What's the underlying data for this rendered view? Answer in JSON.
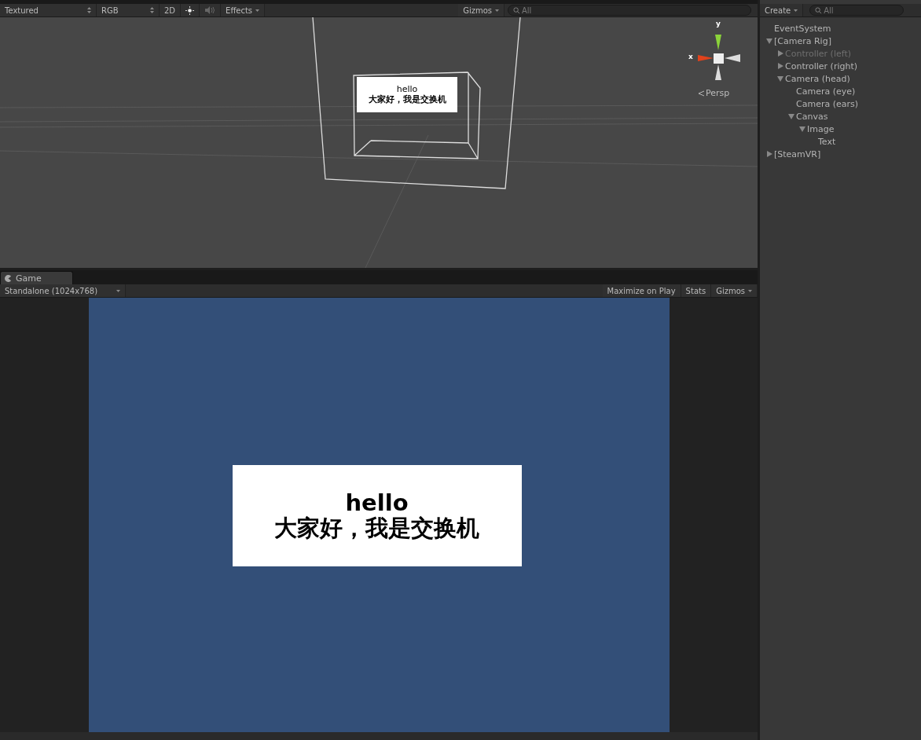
{
  "scene_toolbar": {
    "shading": "Textured",
    "channel": "RGB",
    "mode_2d": "2D",
    "lighting_on": true,
    "audio_on": false,
    "effects": "Effects",
    "gizmos": "Gizmos",
    "search": {
      "placeholder": "All"
    }
  },
  "scene_view": {
    "card_title": "hello",
    "card_text": "大家好，我是交换机",
    "gizmo_x": "x",
    "gizmo_y": "y",
    "projection": "Persp"
  },
  "game_tab": {
    "label": "Game",
    "selected": true
  },
  "game_toolbar": {
    "resolution": "Standalone (1024x768)",
    "maximize_on_play": "Maximize on Play",
    "stats": "Stats",
    "gizmos": "Gizmos"
  },
  "game_view": {
    "card_title": "hello",
    "card_text": "大家好，我是交换机"
  },
  "hierarchy": {
    "create": "Create",
    "search": {
      "placeholder": "All"
    },
    "items": [
      {
        "label": "EventSystem",
        "disabled": false
      },
      {
        "label": "[Camera Rig]",
        "disabled": false,
        "expanded": true,
        "children": [
          {
            "label": "Controller (left)",
            "disabled": true,
            "expanded": false
          },
          {
            "label": "Controller (right)",
            "disabled": false,
            "expanded": false
          },
          {
            "label": "Camera (head)",
            "disabled": false,
            "expanded": true,
            "children": [
              {
                "label": "Camera (eye)",
                "disabled": false
              },
              {
                "label": "Camera (ears)",
                "disabled": false
              },
              {
                "label": "Canvas",
                "disabled": false,
                "expanded": true,
                "children": [
                  {
                    "label": "Image",
                    "disabled": false,
                    "expanded": true,
                    "children": [
                      {
                        "label": "Text",
                        "disabled": false
                      }
                    ]
                  }
                ]
              }
            ]
          }
        ]
      },
      {
        "label": "[SteamVR]",
        "disabled": false,
        "expanded": false
      }
    ]
  }
}
